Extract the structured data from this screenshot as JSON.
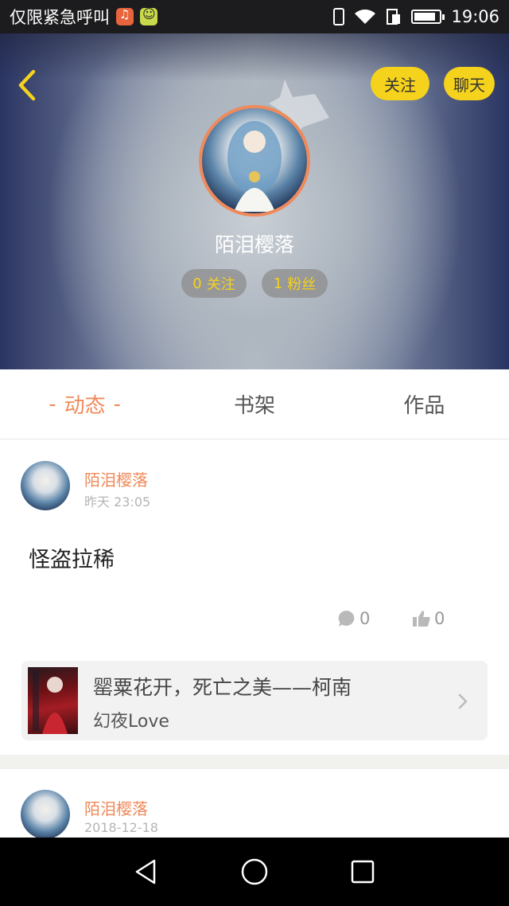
{
  "status_bar": {
    "carrier": "仅限紧急呼叫",
    "time": "19:06",
    "icons": [
      "music-app-icon",
      "emoji-app-icon",
      "vibrate-icon",
      "wifi-icon",
      "sim-icon",
      "battery-icon"
    ]
  },
  "header": {
    "back_icon": "chevron-left-icon",
    "follow_label": "关注",
    "chat_label": "聊天",
    "username": "陌泪樱落",
    "following_count": "0",
    "following_label": "关注",
    "fans_count": "1",
    "fans_label": "粉丝"
  },
  "tabs": [
    {
      "label": "动态",
      "active": true
    },
    {
      "label": "书架",
      "active": false
    },
    {
      "label": "作品",
      "active": false
    }
  ],
  "active_tab_dash": "-",
  "posts": [
    {
      "author": "陌泪樱落",
      "time": "昨天 23:05",
      "text": "怪盗拉稀",
      "comments": "0",
      "likes": "0",
      "book": {
        "title": "罂粟花开，死亡之美——柯南",
        "author": "幻夜Love"
      }
    },
    {
      "author": "陌泪樱落",
      "time": "2018-12-18"
    }
  ],
  "colors": {
    "accent": "#ef8a5b",
    "yellow": "#f5d21c"
  }
}
